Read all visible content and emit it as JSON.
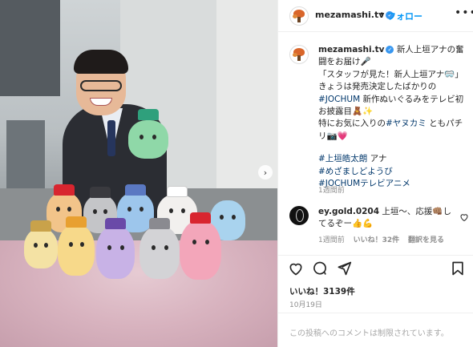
{
  "post": {
    "username": "mezamashi.tv",
    "follow_separator": "•",
    "follow_label": "フォロー",
    "more_label": "•••",
    "next_label": "›"
  },
  "caption": {
    "username": "mezamashi.tv",
    "lines": [
      "新人上垣アナの奮闘をお届け🎤",
      "「スタッフが見た！新人上垣アナ🥽」",
      "きょうは発売決定したばかりの",
      "新作ぬいぐるみをテレビ初お披露目🧸✨",
      "特にお気に入りの",
      "ともパチリ📷💗"
    ],
    "hashtags": {
      "jochum": "#JOCHUM",
      "yanukami": "#ヤヌカミ",
      "kamigaki": "#上垣皓太朗",
      "mezamashi": "#めざましどようび",
      "anime": "#JOCHUMテレビアニメ"
    },
    "kamigaki_suffix": "アナ",
    "time": "1週間前"
  },
  "comment": {
    "username": "ey.gold.0204",
    "text": "上垣〜、応援👊🏽してるぞー👍💪",
    "time": "1週間前",
    "likes": "いいね！32件",
    "reply": "翻訳を見る"
  },
  "likes_count": "いいね！3139件",
  "date": "10月19日",
  "comments_disabled": "この投稿へのコメントは制限されています。"
}
